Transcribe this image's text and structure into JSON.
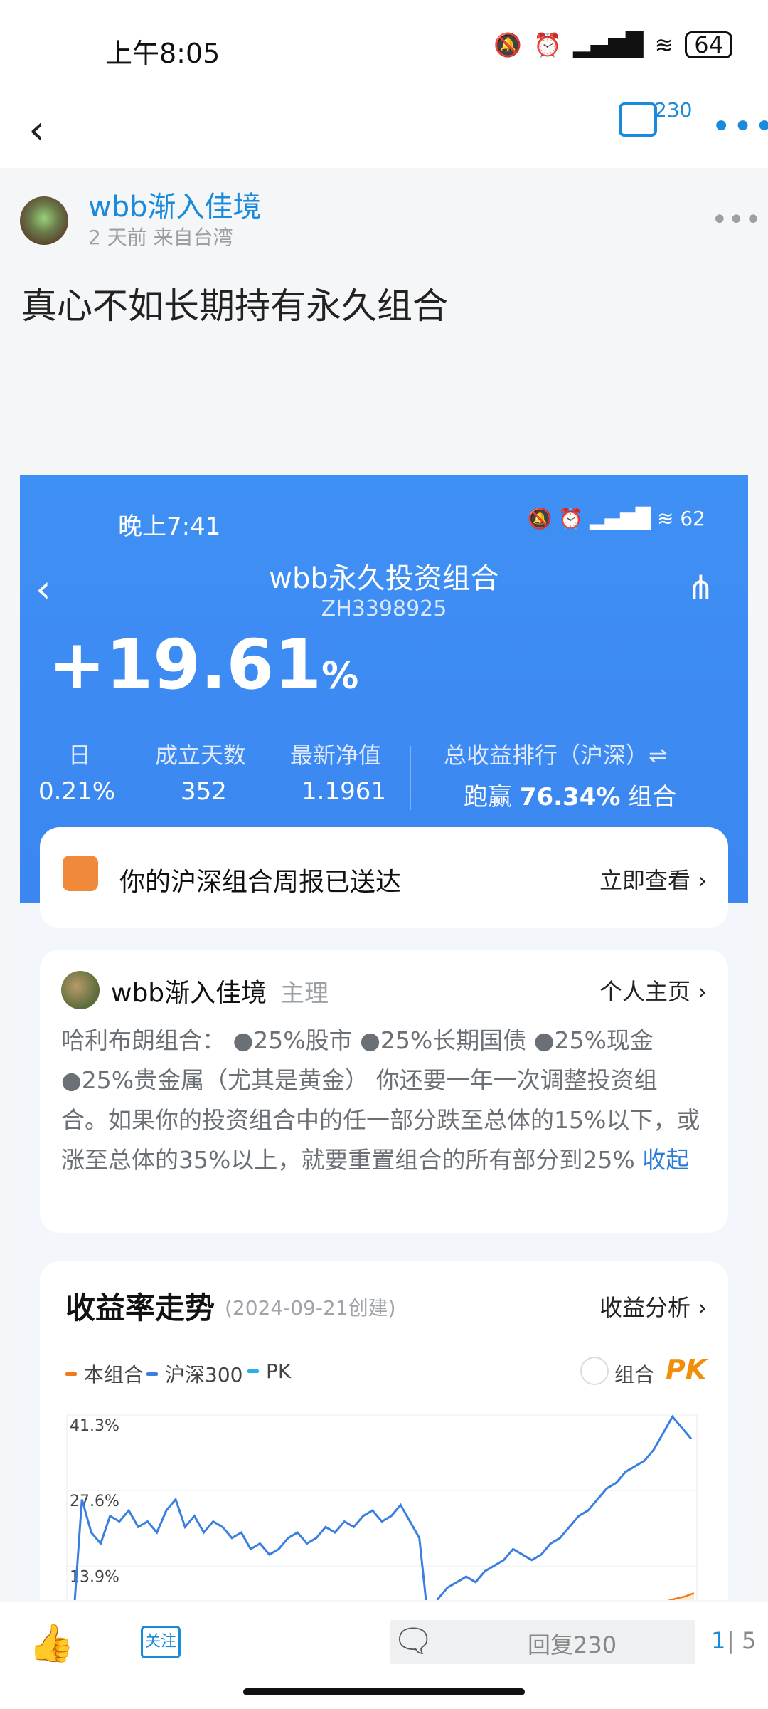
{
  "status_bar": {
    "time": "上午8:05",
    "battery": "64"
  },
  "nav": {
    "comment_count": "230"
  },
  "post": {
    "author": "wbb渐入佳境",
    "meta": "2 天前  来自台湾",
    "title": "真心不如长期持有永久组合"
  },
  "embedded": {
    "status_time": "晚上7:41",
    "status_battery": "62",
    "title": "wbb永久投资组合",
    "code": "ZH3398925",
    "total_return": "+19.61",
    "total_return_unit": "%",
    "stats": [
      {
        "label": "日",
        "value": "0.21%"
      },
      {
        "label": "成立天数",
        "value": "352"
      },
      {
        "label": "最新净值",
        "value": "1.1961"
      }
    ],
    "rank_label": "总收益排行（沪深）⇌",
    "rank_prefix": "跑赢",
    "rank_value": "76.34%",
    "rank_suffix": "组合",
    "report": {
      "text": "你的沪深组合周报已送达",
      "link": "立即查看 ›"
    },
    "bio": {
      "name": "wbb渐入佳境",
      "role": "主理",
      "link": "个人主页 ›",
      "text": "哈利布朗组合： ●25%股市 ●25%长期国债 ●25%现金 ●25%贵金属（尤其是黄金） 你还要一年一次调整投资组合。如果你的投资组合中的任一部分跌至总体的15%以下，或涨至总体的35%以上，就要重置组合的所有部分到25%",
      "collapse": "收起"
    },
    "chart_header": {
      "title": "收益率走势",
      "created": "(2024-09-21创建)",
      "link": "收益分析 ›",
      "pk_label": "组合",
      "pk_badge": "PK"
    }
  },
  "chart_data": {
    "type": "line",
    "legend": [
      "本组合",
      "沪深300",
      "PK"
    ],
    "colors": {
      "本组合": "#f07a1a",
      "沪深300": "#3a7fe0",
      "PK": "#2ab0e8"
    },
    "y_ticks": [
      "41.3%",
      "27.6%",
      "13.9%"
    ],
    "ylim": [
      0,
      41.3
    ],
    "series": [
      {
        "name": "沪深300",
        "values": [
          2,
          26,
          20,
          18,
          23,
          22,
          24,
          21,
          22,
          20,
          24,
          26,
          21,
          23,
          20,
          22,
          21,
          19,
          20,
          17,
          18,
          16,
          17,
          19,
          20,
          18,
          19,
          21,
          20,
          22,
          21,
          23,
          24,
          22,
          23,
          25,
          22,
          19,
          3,
          8,
          10,
          11,
          12,
          11,
          13,
          14,
          15,
          17,
          16,
          15,
          16,
          18,
          19,
          21,
          23,
          24,
          26,
          28,
          29,
          31,
          32,
          33,
          35,
          38,
          41,
          39,
          37
        ]
      },
      {
        "name": "本组合",
        "values": [
          0,
          0.5,
          0.4,
          0.8,
          1.0,
          1.2,
          1.5,
          1.4,
          1.8,
          2.0,
          2.2,
          2.5,
          3.0,
          3.2,
          3.5,
          3.8,
          4.0,
          4.4,
          4.8,
          5.2,
          5.6,
          6.0,
          6.5,
          7.0,
          7.2,
          7.5,
          8.0,
          8.4,
          9.0
        ]
      }
    ]
  },
  "bottom_bar": {
    "follow": "关注",
    "reply": "回复230",
    "page_current": "1",
    "page_rest": "| 5"
  }
}
